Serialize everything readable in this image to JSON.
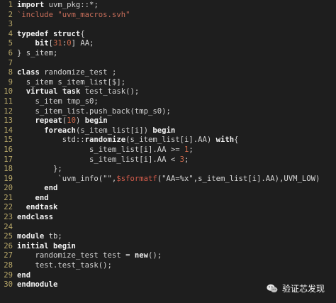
{
  "watermark": {
    "text": "验证芯发现",
    "icon": "wechat-icon"
  },
  "lines": [
    {
      "n": "1",
      "segs": [
        {
          "t": "import",
          "c": "kw"
        },
        {
          "t": " uvm_pkg::*;",
          "c": ""
        }
      ]
    },
    {
      "n": "2",
      "segs": [
        {
          "t": "`include \"uvm_macros.svh\"",
          "c": "pp"
        }
      ]
    },
    {
      "n": "3",
      "segs": []
    },
    {
      "n": "4",
      "segs": [
        {
          "t": "typedef",
          "c": "kw"
        },
        {
          "t": " ",
          "c": ""
        },
        {
          "t": "struct",
          "c": "kw"
        },
        {
          "t": "{",
          "c": ""
        }
      ]
    },
    {
      "n": "5",
      "segs": [
        {
          "t": "    ",
          "c": ""
        },
        {
          "t": "bit",
          "c": "kw"
        },
        {
          "t": "[",
          "c": ""
        },
        {
          "t": "31",
          "c": "num"
        },
        {
          "t": ":",
          "c": ""
        },
        {
          "t": "0",
          "c": "num"
        },
        {
          "t": "] AA;",
          "c": ""
        }
      ]
    },
    {
      "n": "6",
      "segs": [
        {
          "t": "} s_item;",
          "c": ""
        }
      ]
    },
    {
      "n": "7",
      "segs": []
    },
    {
      "n": "8",
      "segs": [
        {
          "t": "class",
          "c": "kw"
        },
        {
          "t": " randomize_test ;",
          "c": ""
        }
      ]
    },
    {
      "n": "9",
      "segs": [
        {
          "t": "  s_item s_item_list[$];",
          "c": ""
        }
      ]
    },
    {
      "n": "10",
      "segs": [
        {
          "t": "  ",
          "c": ""
        },
        {
          "t": "virtual",
          "c": "kw"
        },
        {
          "t": " ",
          "c": ""
        },
        {
          "t": "task",
          "c": "kw"
        },
        {
          "t": " test_task();",
          "c": ""
        }
      ]
    },
    {
      "n": "11",
      "segs": [
        {
          "t": "    s_item tmp_s0;",
          "c": ""
        }
      ]
    },
    {
      "n": "12",
      "segs": [
        {
          "t": "    s_item_list.push_back(tmp_s0);",
          "c": ""
        }
      ]
    },
    {
      "n": "13",
      "segs": [
        {
          "t": "    ",
          "c": ""
        },
        {
          "t": "repeat",
          "c": "kw"
        },
        {
          "t": "(",
          "c": ""
        },
        {
          "t": "10",
          "c": "num"
        },
        {
          "t": ") ",
          "c": ""
        },
        {
          "t": "begin",
          "c": "kw"
        }
      ]
    },
    {
      "n": "14",
      "segs": [
        {
          "t": "      ",
          "c": ""
        },
        {
          "t": "foreach",
          "c": "kw"
        },
        {
          "t": "(s_item_list[i]) ",
          "c": ""
        },
        {
          "t": "begin",
          "c": "kw"
        }
      ]
    },
    {
      "n": "15",
      "segs": [
        {
          "t": "          std::",
          "c": ""
        },
        {
          "t": "randomize",
          "c": "fn"
        },
        {
          "t": "(s_item_list[i].AA) ",
          "c": ""
        },
        {
          "t": "with",
          "c": "kw"
        },
        {
          "t": "{",
          "c": ""
        }
      ]
    },
    {
      "n": "16",
      "segs": [
        {
          "t": "                s_item_list[i].AA >= ",
          "c": ""
        },
        {
          "t": "1",
          "c": "num"
        },
        {
          "t": ";",
          "c": ""
        }
      ]
    },
    {
      "n": "17",
      "segs": [
        {
          "t": "                s_item_list[i].AA < ",
          "c": ""
        },
        {
          "t": "3",
          "c": "num"
        },
        {
          "t": ";",
          "c": ""
        }
      ]
    },
    {
      "n": "18",
      "segs": [
        {
          "t": "        };",
          "c": ""
        }
      ]
    },
    {
      "n": "19",
      "segs": [
        {
          "t": "         `uvm_info(\"\",",
          "c": "mac"
        },
        {
          "t": "$sformatf",
          "c": "sysf"
        },
        {
          "t": "(\"AA=%x\",s_item_list[i].AA),UVM_LOW)",
          "c": "mac"
        }
      ]
    },
    {
      "n": "20",
      "segs": [
        {
          "t": "      ",
          "c": ""
        },
        {
          "t": "end",
          "c": "kw"
        }
      ]
    },
    {
      "n": "21",
      "segs": [
        {
          "t": "    ",
          "c": ""
        },
        {
          "t": "end",
          "c": "kw"
        }
      ]
    },
    {
      "n": "22",
      "segs": [
        {
          "t": "  ",
          "c": ""
        },
        {
          "t": "endtask",
          "c": "kw"
        }
      ]
    },
    {
      "n": "23",
      "segs": [
        {
          "t": "endclass",
          "c": "kw"
        }
      ]
    },
    {
      "n": "24",
      "segs": []
    },
    {
      "n": "25",
      "segs": [
        {
          "t": "module",
          "c": "kw"
        },
        {
          "t": " tb;",
          "c": ""
        }
      ]
    },
    {
      "n": "26",
      "segs": [
        {
          "t": "initial",
          "c": "kw"
        },
        {
          "t": " ",
          "c": ""
        },
        {
          "t": "begin",
          "c": "kw"
        }
      ]
    },
    {
      "n": "27",
      "segs": [
        {
          "t": "    randomize_test test = ",
          "c": ""
        },
        {
          "t": "new",
          "c": "kw"
        },
        {
          "t": "();",
          "c": ""
        }
      ]
    },
    {
      "n": "28",
      "segs": [
        {
          "t": "    test.test_task();",
          "c": ""
        }
      ]
    },
    {
      "n": "29",
      "segs": [
        {
          "t": "end",
          "c": "kw"
        }
      ]
    },
    {
      "n": "30",
      "segs": [
        {
          "t": "endmodule",
          "c": "kw"
        }
      ]
    }
  ]
}
